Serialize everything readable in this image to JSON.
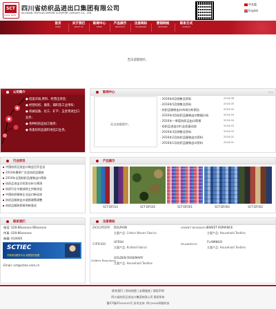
{
  "header": {
    "logo_mark": "SCT",
    "logo_since": "Since 1978",
    "company_cn": "四川省纺织品进出口集团有限公司",
    "company_en": "SICHUAN TEXTILES IMPORT & EXPORT (GROUP) CO., LTD.",
    "lang_cn": "中文版",
    "lang_en": "English"
  },
  "nav": [
    {
      "label": "首页",
      "sub": "HOME"
    },
    {
      "label": "关于我们",
      "sub": "ABOUT US"
    },
    {
      "label": "新闻中心",
      "sub": "NEWS"
    },
    {
      "label": "产品展示",
      "sub": "PRODUCTS"
    },
    {
      "label": "注册商标",
      "sub": "TRADEMARK"
    },
    {
      "label": "营销网络",
      "sub": "NETWORK"
    },
    {
      "label": "联系方式",
      "sub": "CONTACT"
    }
  ],
  "banner": {
    "text": "无法读取图片。"
  },
  "profile": {
    "title": "公司简介",
    "lines": [
      "● 结晶华丽,原料、经营出资金;",
      "● 经营纺织、服装、辅料及工业用布;",
      "● 机械设备、化工、矿产、五金等进出口",
      "  业务;",
      "● 各种纺织品加工服务;",
      "● 各类纺织品面料进出口业务。"
    ]
  },
  "news": {
    "title": "新闻中心",
    "more": "more",
    "pic_text": "无法加载图片。",
    "items": [
      {
        "text": "· 2016年6月销售及资料",
        "date": "2016-06"
      },
      {
        "text": "· 2016年5月销售及资料",
        "date": "2016-05"
      },
      {
        "text": "· 纺织品服装出口市场分析报告",
        "date": "2016-05"
      },
      {
        "text": "· 2016年4月纺织品服装出口数据分析",
        "date": "2016-04"
      },
      {
        "text": "· 2016年一季度纺织品出口简报",
        "date": "2016-04"
      },
      {
        "text": "· 纺织品进出口行业发展动态",
        "date": "2016-03"
      },
      {
        "text": "· 2016年3月销售及资料",
        "date": "2016-03"
      },
      {
        "text": "· 2016年2月纺织品服装出口资料",
        "date": "2016-02"
      },
      {
        "text": "· 2016年1月纺织品服装出口资料",
        "date": "2016-01"
      }
    ]
  },
  "industry": {
    "title": "行业资讯",
    "items": [
      "中国纺织品进出口商会召开会议",
      "2016年春季广交会纺织品服装",
      "2016年全国纺织品服装出口简析",
      "纺织品进出口形势分析与预测",
      "纺织行业节能减排工作推进会",
      "中国纺织服装企业出口新动态",
      "纺织品服装出口退税政策调整",
      "纺织品服装贸易的新变化"
    ]
  },
  "products": {
    "title": "产品展示",
    "items": [
      {
        "caption": "SCT-DF014"
      },
      {
        "caption": "SCT-DF026"
      },
      {
        "caption": "SCT-DF001"
      },
      {
        "caption": "SCT-DF004"
      },
      {
        "caption": "SCT-DF002"
      }
    ]
  },
  "contact": {
    "title": "联系我们",
    "lines": [
      "电话: 028-86xxxxxx  86xxxxxx",
      "传真: 028-86xxxxxx",
      "邮编: 610000",
      "Email: sct@sctex.com.cn"
    ],
    "ad_big": "SCTIEC",
    "ad_small": "外贸综合服务平台 诚邀您的加盟"
  },
  "brands": {
    "title": "注册商标",
    "items": [
      {
        "logo": "DOLPHIN",
        "name": "DOLPHIN",
        "desc": "主要产品: Cotton Woven Fabrics"
      },
      {
        "logo": "UFESH",
        "name": "UFESH",
        "desc": "主要产品: Knitted Fabrics"
      },
      {
        "logo": "Golden Rosemary",
        "name": "GOLDEN ROSEMARY",
        "desc": "主要产品: Household Textiles"
      },
      {
        "logo": "SWEET ROMANCE",
        "name": "SWEET ROMANCE",
        "desc": "主要产品: Household Textiles"
      },
      {
        "logo": "FLAMINGO",
        "name": "FLAMINGO",
        "desc": "主要产品: Household Textiles"
      }
    ]
  },
  "footer": {
    "line1": "联系我们 | 网站地图 | 友情链接 | 版权声明",
    "line2": "四川省纺织品进出口集团有限公司 版权所有",
    "line3": "蜀ICP备05xxxxxx号 技术支持: 四川xxxx网络科技"
  },
  "colors": {
    "brand": "#b3121f",
    "dark_red": "#7d0d17"
  }
}
